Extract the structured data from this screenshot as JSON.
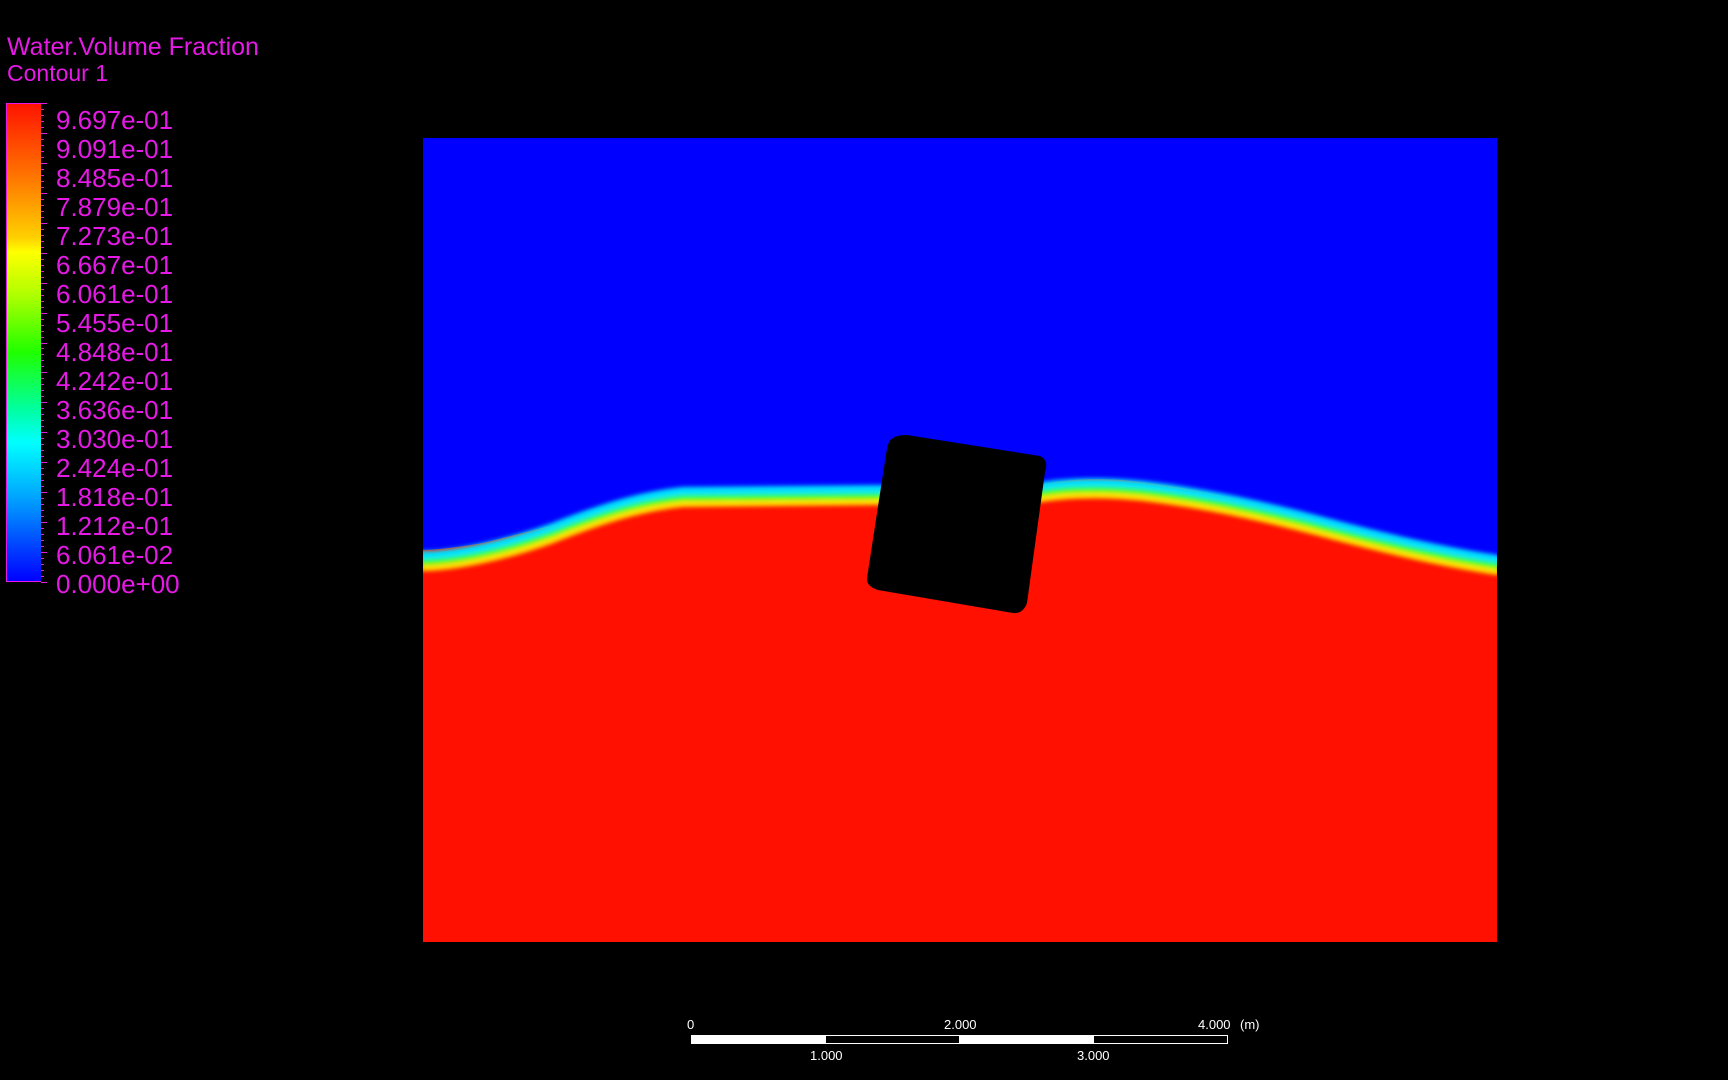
{
  "legend": {
    "variable": "Water.Volume Fraction",
    "name": "Contour 1",
    "labels": [
      "9.697e-01",
      "9.091e-01",
      "8.485e-01",
      "7.879e-01",
      "7.273e-01",
      "6.667e-01",
      "6.061e-01",
      "5.455e-01",
      "4.848e-01",
      "4.242e-01",
      "3.636e-01",
      "3.030e-01",
      "2.424e-01",
      "1.818e-01",
      "1.212e-01",
      "6.061e-02",
      "0.000e+00"
    ],
    "range": [
      0,
      1
    ],
    "text_color": "#e619e6"
  },
  "scene": {
    "water_color": "#ff1000",
    "air_color": "#0000ff",
    "body_color": "#000000",
    "body_label": "floating body (rotated box)"
  },
  "scale_bar": {
    "top_labels": [
      "0",
      "2.000",
      "4.000"
    ],
    "bottom_labels": [
      "1.000",
      "3.000"
    ],
    "unit": "(m)"
  }
}
